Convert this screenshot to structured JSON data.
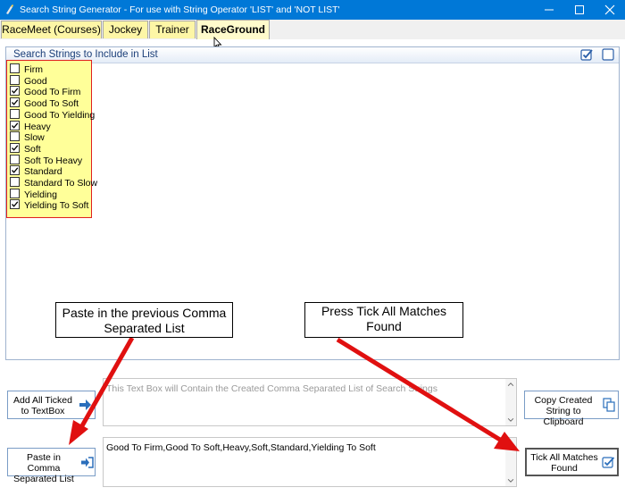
{
  "window": {
    "title": "Search String Generator - For use with String Operator 'LIST' and 'NOT LIST'",
    "titlebar_color": "#0078d7"
  },
  "tabs": [
    {
      "label": "RaceMeet (Courses)",
      "active": false
    },
    {
      "label": "Jockey",
      "active": false
    },
    {
      "label": "Trainer",
      "active": false
    },
    {
      "label": "RaceGround",
      "active": true
    }
  ],
  "panel": {
    "title": "Search Strings to Include in List",
    "header_icons": [
      "tick-all-icon",
      "untick-all-icon"
    ]
  },
  "items": [
    {
      "label": "Firm",
      "checked": false
    },
    {
      "label": "Good",
      "checked": false
    },
    {
      "label": "Good To Firm",
      "checked": true
    },
    {
      "label": "Good To Soft",
      "checked": true
    },
    {
      "label": "Good To Yielding",
      "checked": false
    },
    {
      "label": "Heavy",
      "checked": true
    },
    {
      "label": "Slow",
      "checked": false
    },
    {
      "label": "Soft",
      "checked": true
    },
    {
      "label": "Soft To Heavy",
      "checked": false
    },
    {
      "label": "Standard",
      "checked": true
    },
    {
      "label": "Standard To Slow",
      "checked": false
    },
    {
      "label": "Yielding",
      "checked": false
    },
    {
      "label": "Yielding To Soft",
      "checked": true
    }
  ],
  "buttons": {
    "add_ticked": "Add All Ticked to TextBox",
    "paste_csv": "Paste in Comma Separated List",
    "copy_string": "Copy Created String to Clipboard",
    "tick_matches": "Tick All Matches Found"
  },
  "textbox_top": {
    "placeholder": "This Text Box will Contain the Created Comma Separated List of Search Strings"
  },
  "textbox_bottom": {
    "value": "Good To Firm,Good To Soft,Heavy,Soft,Standard,Yielding To Soft"
  },
  "callouts": {
    "left": "Paste in the previous Comma Separated List",
    "right": "Press Tick All Matches Found"
  },
  "colors": {
    "list_bg": "#ffff99",
    "list_border": "#e02020",
    "arrow": "#e01010",
    "tab_bg": "#fdf6a6"
  }
}
